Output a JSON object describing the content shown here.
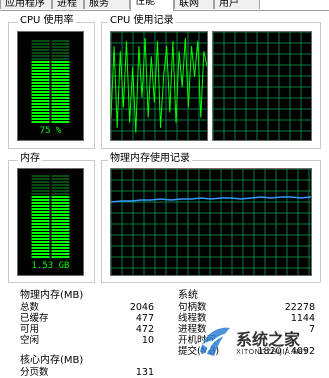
{
  "tabs": [
    {
      "label": "应用程序"
    },
    {
      "label": "进程"
    },
    {
      "label": "服务"
    },
    {
      "label": "性能",
      "active": true
    },
    {
      "label": "联网"
    },
    {
      "label": "用户"
    }
  ],
  "cpu_usage": {
    "title": "CPU 使用率",
    "value_label": "75 %",
    "fill_fraction": 0.75
  },
  "cpu_history": {
    "title": "CPU 使用记录"
  },
  "memory": {
    "title": "内存",
    "value_label": "1.53 GB",
    "fill_fraction": 0.75
  },
  "memory_history": {
    "title": "物理内存使用记录"
  },
  "physical_memory": {
    "title": "物理内存(MB)",
    "rows": [
      {
        "label": "总数",
        "value": "2046"
      },
      {
        "label": "已缓存",
        "value": "477"
      },
      {
        "label": "可用",
        "value": "472"
      },
      {
        "label": "空闲",
        "value": "10"
      }
    ]
  },
  "kernel_memory": {
    "title": "核心内存(MB)",
    "rows": [
      {
        "label": "分页数",
        "value": "131"
      }
    ]
  },
  "system": {
    "title": "系统",
    "rows": [
      {
        "label": "句柄数",
        "value": "22278"
      },
      {
        "label": "线程数",
        "value": "1144"
      },
      {
        "label": "进程数",
        "value": "7"
      },
      {
        "label": "开机时间",
        "value": ""
      },
      {
        "label": "提交(MB)",
        "value": "1820 / 4092"
      }
    ]
  },
  "watermark": {
    "brand": "系统之家",
    "url": "XITONGZHIJIA.NET"
  },
  "colors": {
    "meter_green": "#00ff00",
    "grid_green": "#008040",
    "cpu_line": "#00ff00",
    "mem_line": "#3399ff"
  }
}
